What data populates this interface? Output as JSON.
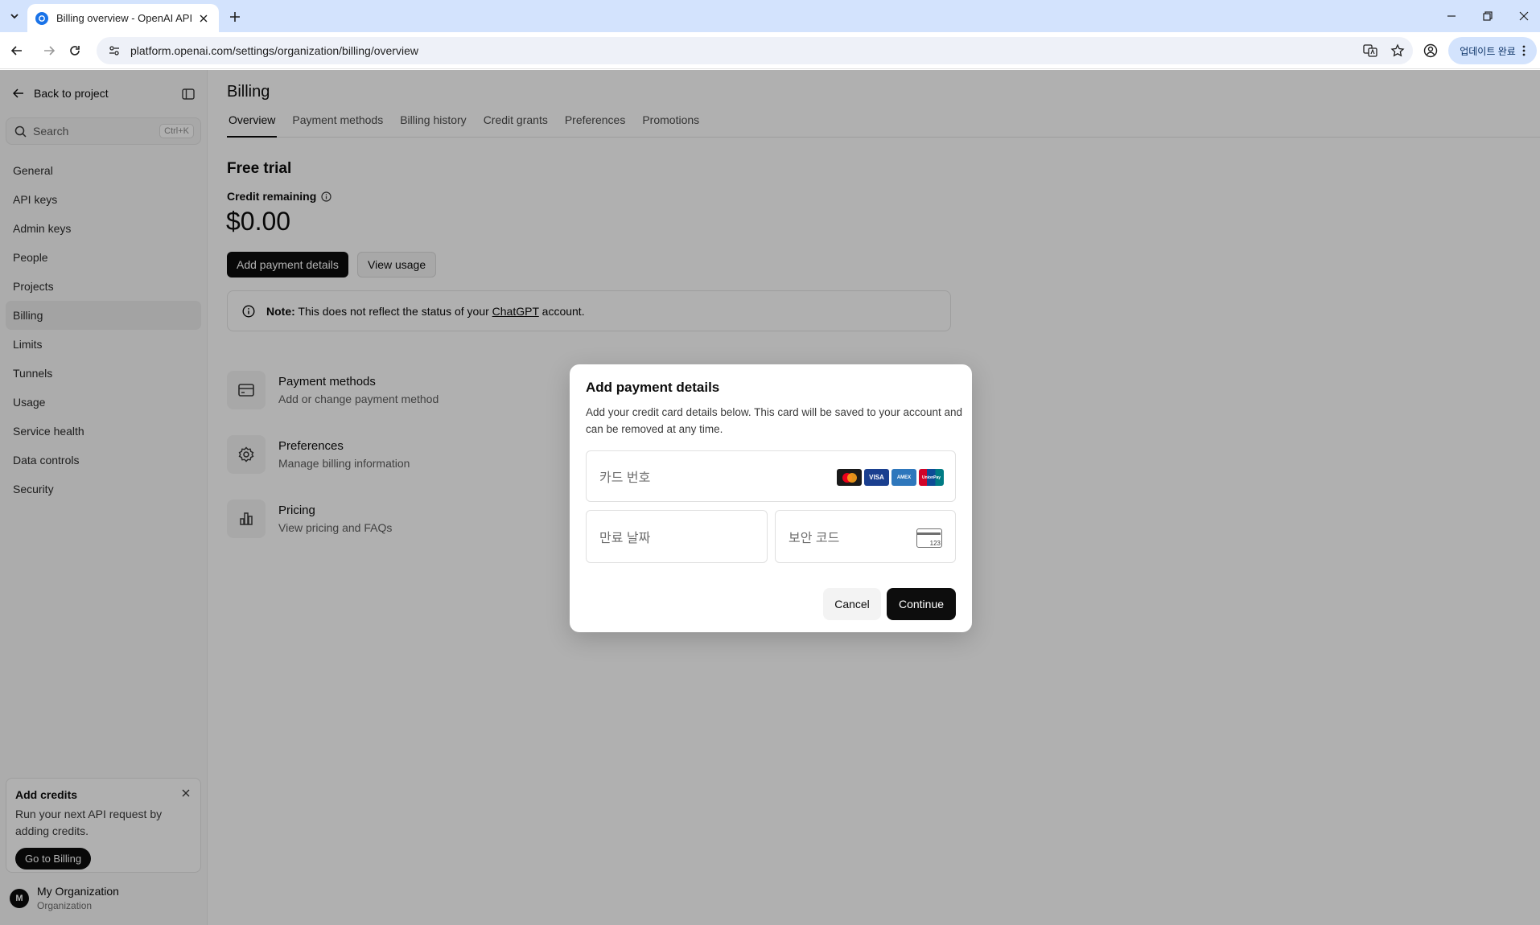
{
  "browser": {
    "tab_title": "Billing overview - OpenAI API",
    "url": "platform.openai.com/settings/organization/billing/overview",
    "update_label": "업데이트 완료"
  },
  "sidebar": {
    "back_label": "Back to project",
    "search_placeholder": "Search",
    "search_shortcut": "Ctrl+K",
    "items": [
      {
        "label": "General"
      },
      {
        "label": "API keys"
      },
      {
        "label": "Admin keys"
      },
      {
        "label": "People"
      },
      {
        "label": "Projects"
      },
      {
        "label": "Billing",
        "active": true
      },
      {
        "label": "Limits"
      },
      {
        "label": "Tunnels"
      },
      {
        "label": "Usage"
      },
      {
        "label": "Service health"
      },
      {
        "label": "Data controls"
      },
      {
        "label": "Security"
      }
    ],
    "promo": {
      "title": "Add credits",
      "text": "Run your next API request by adding credits.",
      "button": "Go to Billing"
    },
    "org": {
      "initial": "M",
      "name": "My Organization",
      "role": "Organization"
    }
  },
  "main": {
    "title": "Billing",
    "tabs": [
      {
        "label": "Overview",
        "active": true
      },
      {
        "label": "Payment methods"
      },
      {
        "label": "Billing history"
      },
      {
        "label": "Credit grants"
      },
      {
        "label": "Preferences"
      },
      {
        "label": "Promotions"
      }
    ],
    "plan": "Free trial",
    "credit_label": "Credit remaining",
    "credit_amount": "$0.00",
    "add_payment_button": "Add payment details",
    "view_usage_button": "View usage",
    "note": {
      "prefix": "Note:",
      "text_before": " This does not reflect the status of your ",
      "link": "ChatGPT",
      "text_after": " account."
    },
    "links": [
      {
        "title": "Payment methods",
        "subtitle": "Add or change payment method",
        "icon": "credit-card-icon"
      },
      {
        "title": "Preferences",
        "subtitle": "Manage billing information",
        "icon": "gear-icon"
      },
      {
        "title": "Pricing",
        "subtitle": "View pricing and FAQs",
        "icon": "bar-chart-icon"
      }
    ]
  },
  "modal": {
    "title": "Add payment details",
    "description": "Add your credit card details below. This card will be saved to your account and can be removed at any time.",
    "card_number_placeholder": "카드 번호",
    "expiry_placeholder": "만료 날짜",
    "cvc_placeholder": "보안 코드",
    "cvc_icon_text": "123",
    "brands": [
      "mastercard",
      "VISA",
      "AMEX",
      "UnionPay"
    ],
    "cancel": "Cancel",
    "continue": "Continue"
  },
  "colors": {
    "primary": "#0d0d0d",
    "chrome_blue": "#d3e3fd",
    "overlay": "rgba(0,0,0,0.31)"
  }
}
